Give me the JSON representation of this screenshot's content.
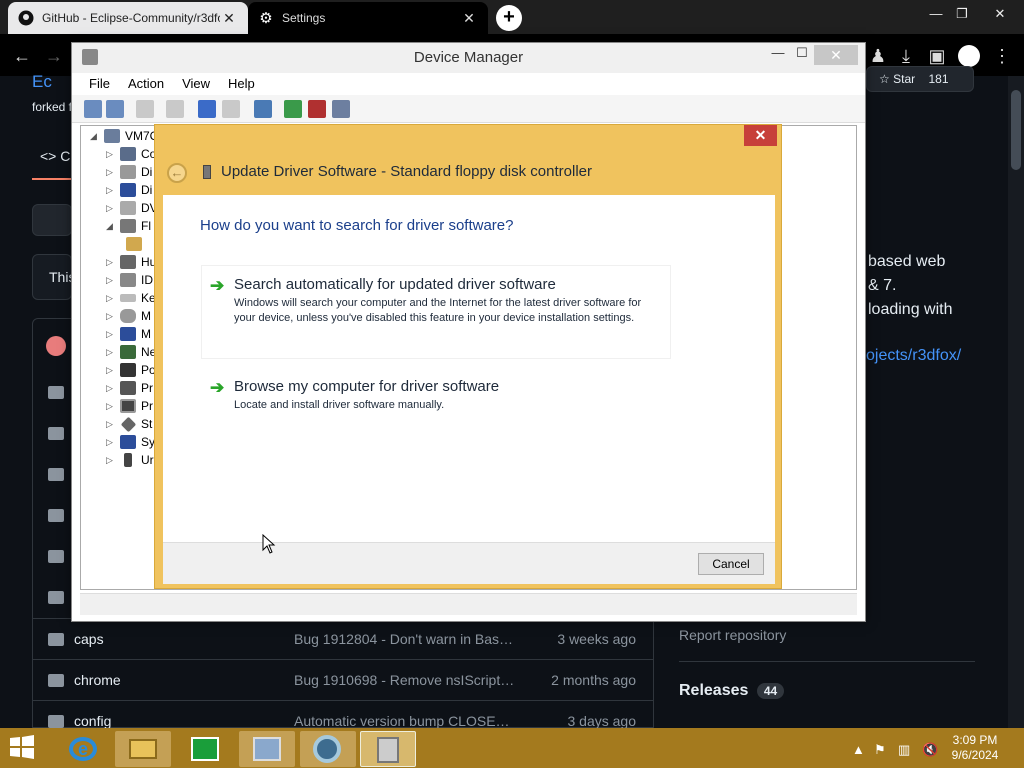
{
  "browser": {
    "tabs": [
      {
        "title": "GitHub - Eclipse-Community/r3dfox",
        "icon": "github-icon"
      },
      {
        "title": "Settings",
        "icon": "gear-icon"
      }
    ],
    "new_tab_label": "+"
  },
  "github": {
    "repo_title_partial": "Ec",
    "forked_partial": "forked f",
    "code_tab_partial": "C",
    "this_partial": "This",
    "star_label": "Star",
    "star_count": "181",
    "about_text": [
      "based web",
      "& 7.",
      "loading with"
    ],
    "about_link": "ojects/r3dfox/",
    "files": [
      {
        "name": "caps",
        "message": "Bug 1912804 - Don't warn in Base...",
        "time": "3 weeks ago"
      },
      {
        "name": "chrome",
        "message": "Bug 1910698 - Remove nsIScriptE...",
        "time": "2 months ago"
      },
      {
        "name": "config",
        "message": "Automatic version bump CLOSED ...",
        "time": "3 days ago"
      }
    ],
    "report_label": "Report repository",
    "releases_label": "Releases",
    "releases_count": "44"
  },
  "device_manager": {
    "title": "Device Manager",
    "menu": [
      "File",
      "Action",
      "View",
      "Help"
    ],
    "root": "VM7C",
    "tree": [
      {
        "label": "Co",
        "icon": "computer-icon"
      },
      {
        "label": "Di",
        "icon": "disk-icon"
      },
      {
        "label": "Di",
        "icon": "display-icon"
      },
      {
        "label": "DV",
        "icon": "dvd-icon"
      },
      {
        "label": "Fl",
        "icon": "floppy-icon",
        "expanded": true
      },
      {
        "label": "",
        "icon": "controller-icon",
        "child": true
      },
      {
        "label": "Hu",
        "icon": "hid-icon"
      },
      {
        "label": "ID",
        "icon": "ide-icon"
      },
      {
        "label": "Ke",
        "icon": "keyboard-icon"
      },
      {
        "label": "M",
        "icon": "mouse-icon"
      },
      {
        "label": "M",
        "icon": "monitor-icon"
      },
      {
        "label": "Ne",
        "icon": "network-icon"
      },
      {
        "label": "Po",
        "icon": "port-icon"
      },
      {
        "label": "Pr",
        "icon": "printer-icon"
      },
      {
        "label": "Pr",
        "icon": "processor-icon"
      },
      {
        "label": "St",
        "icon": "storage-icon"
      },
      {
        "label": "Sy",
        "icon": "system-icon"
      },
      {
        "label": "Ur",
        "icon": "usb-icon"
      }
    ]
  },
  "update_driver": {
    "title": "Update Driver Software - Standard floppy disk controller",
    "question": "How do you want to search for driver software?",
    "options": [
      {
        "heading": "Search automatically for updated driver software",
        "desc": "Windows will search your computer and the Internet for the latest driver software for your device, unless you've disabled this feature in your device installation settings."
      },
      {
        "heading": "Browse my computer for driver software",
        "desc": "Locate and install driver software manually."
      }
    ],
    "cancel_label": "Cancel"
  },
  "taskbar": {
    "time": "3:09 PM",
    "date": "9/6/2024",
    "apps": [
      "ie-icon",
      "explorer-icon",
      "store-icon",
      "performance-icon",
      "chrome-icon",
      "device-manager-icon"
    ]
  },
  "colors": {
    "dialog_border": "#f0c35e",
    "taskbar": "#a47a1e",
    "question": "#1b3f8b",
    "option_arrow": "#2aa52a"
  }
}
